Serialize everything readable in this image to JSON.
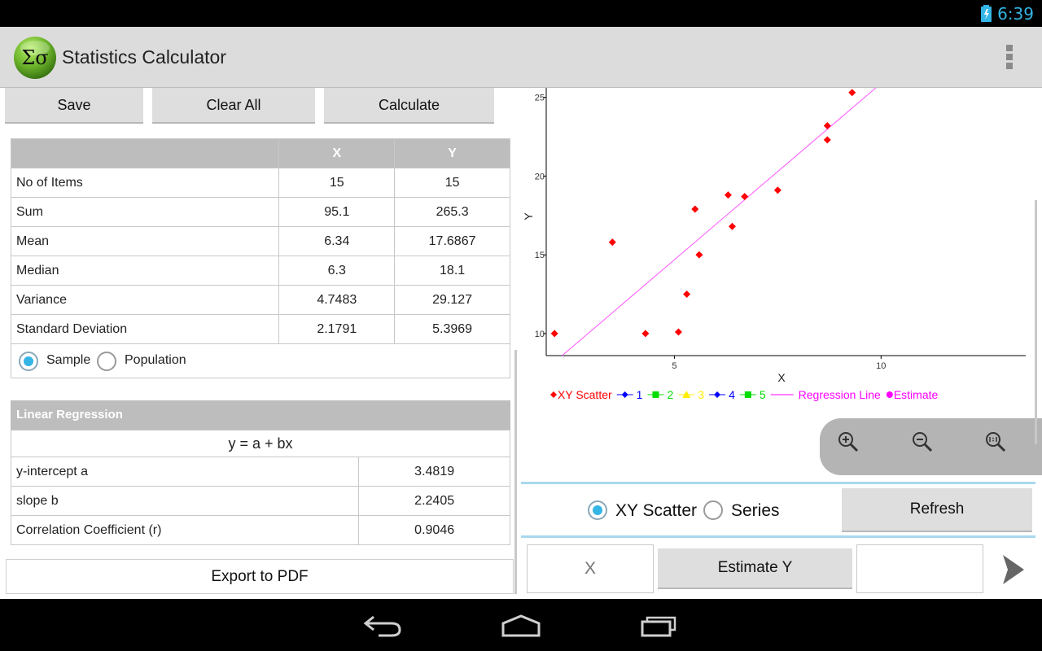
{
  "status_bar": {
    "time": "6:39"
  },
  "app": {
    "title": "Statistics Calculator",
    "icon_text": "Σσ"
  },
  "toolbar": {
    "save_label": "Save",
    "clear_label": "Clear All",
    "calculate_label": "Calculate"
  },
  "stats": {
    "columns": [
      "",
      "X",
      "Y"
    ],
    "rows": [
      {
        "label": "No of Items",
        "x": "15",
        "y": "15"
      },
      {
        "label": "Sum",
        "x": "95.1",
        "y": "265.3"
      },
      {
        "label": "Mean",
        "x": "6.34",
        "y": "17.6867"
      },
      {
        "label": "Median",
        "x": "6.3",
        "y": "18.1"
      },
      {
        "label": "Variance",
        "x": "4.7483",
        "y": "29.127"
      },
      {
        "label": "Standard Deviation",
        "x": "2.1791",
        "y": "5.3969"
      }
    ],
    "mode_options": [
      {
        "label": "Sample",
        "selected": true
      },
      {
        "label": "Population",
        "selected": false
      }
    ]
  },
  "regression": {
    "title": "Linear Regression",
    "equation": "y = a + bx",
    "rows": [
      {
        "label": "y-intercept a",
        "value": "3.4819"
      },
      {
        "label": "slope b",
        "value": "2.2405"
      },
      {
        "label": "Correlation Coefficient (r)",
        "value": "0.9046"
      }
    ]
  },
  "export_label": "Export to PDF",
  "chart_data": {
    "type": "scatter",
    "xlabel": "X",
    "ylabel": "Y",
    "xlim": [
      1.9,
      13.5
    ],
    "ylim": [
      8.6,
      25.6
    ],
    "x_ticks": [
      "5",
      "10"
    ],
    "y_ticks": [
      "10",
      "15",
      "20",
      "25"
    ],
    "series": [
      {
        "name": "XY Scatter",
        "color": "#ff0000",
        "x": [
          2.1,
          3.5,
          4.3,
          5.1,
          5.3,
          5.5,
          5.6,
          6.3,
          6.4,
          6.7,
          7.5,
          8.7,
          8.7,
          9.3
        ],
        "y": [
          10.0,
          15.8,
          10.0,
          10.1,
          12.5,
          17.9,
          15.0,
          18.8,
          16.8,
          18.7,
          19.1,
          22.3,
          23.2,
          25.3
        ]
      }
    ],
    "regression_line": {
      "name": "Regression Line",
      "color": "#ff55ff",
      "intercept": 3.4819,
      "slope": 2.2405
    },
    "legend": [
      {
        "label": "XY Scatter",
        "color": "#ff0000",
        "marker": "diamond"
      },
      {
        "label": "1",
        "color": "#0000ff",
        "marker": "diamond"
      },
      {
        "label": "2",
        "color": "#00dd00",
        "marker": "square"
      },
      {
        "label": "3",
        "color": "#ffee00",
        "marker": "triangle"
      },
      {
        "label": "4",
        "color": "#0000ff",
        "marker": "diamond"
      },
      {
        "label": "5",
        "color": "#00dd00",
        "marker": "square"
      },
      {
        "label": "Regression Line",
        "color": "#ff00ff",
        "marker": "line"
      },
      {
        "label": "Estimate",
        "color": "#ff00ff",
        "marker": "circle"
      }
    ],
    "legend_position": "bottom",
    "grid": false
  },
  "chart_controls": {
    "type_options": [
      {
        "label": "XY Scatter",
        "selected": true
      },
      {
        "label": "Series",
        "selected": false
      }
    ],
    "refresh_label": "Refresh",
    "x_placeholder": "X",
    "estimate_label": "Estimate Y"
  }
}
